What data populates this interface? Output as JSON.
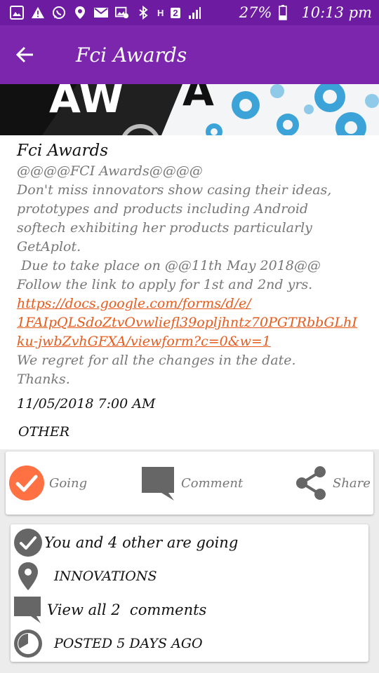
{
  "status_bar": {
    "network": "H",
    "sim": "2",
    "battery": "27%",
    "time": "10:13 pm"
  },
  "app_bar": {
    "title": "Fci Awards"
  },
  "event": {
    "title": "Fci Awards",
    "description_lines": [
      "@@@@FCI Awards@@@@",
      "Don't miss innovators show casing their ideas,",
      "prototypes and products including Android",
      "softech exhibiting her products particularly",
      "GetAplot.",
      " Due to take place on @@11th May 2018@@",
      "Follow the link to apply for 1st and 2nd yrs."
    ],
    "link_lines": [
      "https://docs.google.com/forms/d/e/",
      "1FAIpQLSdoZtvOvwliefl39opljhntz70PGTRbbGLhI",
      "ku-jwbZvhGFXA/viewform?c=0&w=1"
    ],
    "closing_lines": [
      "We regret for all the changes in the date.",
      "Thanks."
    ],
    "datetime": "11/05/2018 7:00 AM",
    "category": "OTHER"
  },
  "actions": {
    "going": "Going",
    "comment": "Comment",
    "share": "Share"
  },
  "info": {
    "attendees": "You and 4 other are going",
    "location": "INNOVATIONS",
    "comments": "View all 2  comments",
    "posted": "POSTED 5 DAYS AGO"
  },
  "colors": {
    "status_bar": "#6d1ba0",
    "app_bar": "#7b26ad",
    "going_accent": "#ff7043",
    "link": "#e65a1c",
    "icon_gray": "#666666"
  }
}
